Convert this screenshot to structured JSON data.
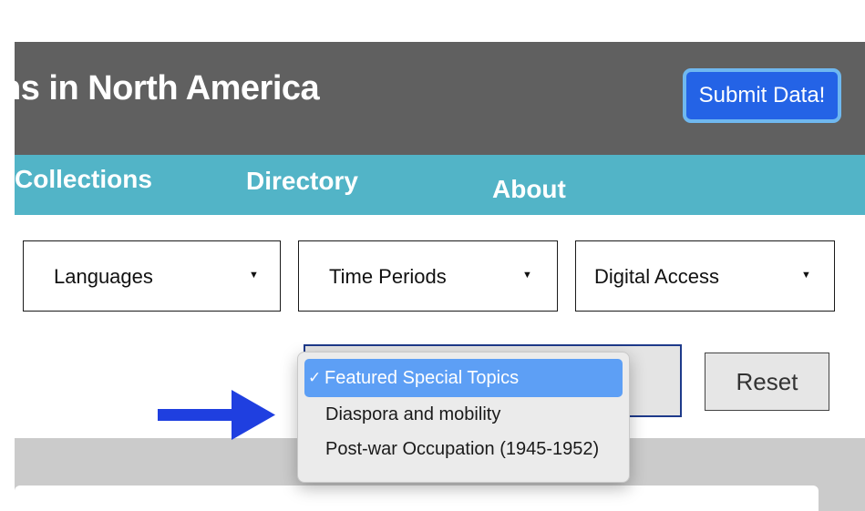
{
  "header": {
    "title": "ns in North America",
    "submit_label": "Submit Data!"
  },
  "nav": {
    "items": [
      {
        "label": "Collections"
      },
      {
        "label": "Directory"
      },
      {
        "label": "About"
      }
    ]
  },
  "filters": [
    {
      "label": "Languages",
      "caret": "▼"
    },
    {
      "label": "Time Periods",
      "caret": "▼"
    },
    {
      "label": "Digital Access",
      "caret": "▼"
    }
  ],
  "topic_menu": {
    "options": [
      {
        "label": "Featured Special Topics",
        "selected": true,
        "check": "✓"
      },
      {
        "label": "Diaspora and mobility",
        "selected": false
      },
      {
        "label": "Post-war Occupation (1945-1952)",
        "selected": false
      }
    ]
  },
  "reset_label": "Reset",
  "colors": {
    "header_bg": "#606060",
    "nav_bg": "#52b4c7",
    "submit_bg": "#2463e6",
    "submit_border": "#6fb8f0",
    "menu_selected": "#5d9ff5",
    "arrow": "#1f3fe0",
    "content_band": "#cbcbcb"
  },
  "icons": {
    "annotation_arrow": "arrow-right-icon",
    "filter_caret": "caret-down-icon",
    "checkmark": "checkmark-icon"
  }
}
